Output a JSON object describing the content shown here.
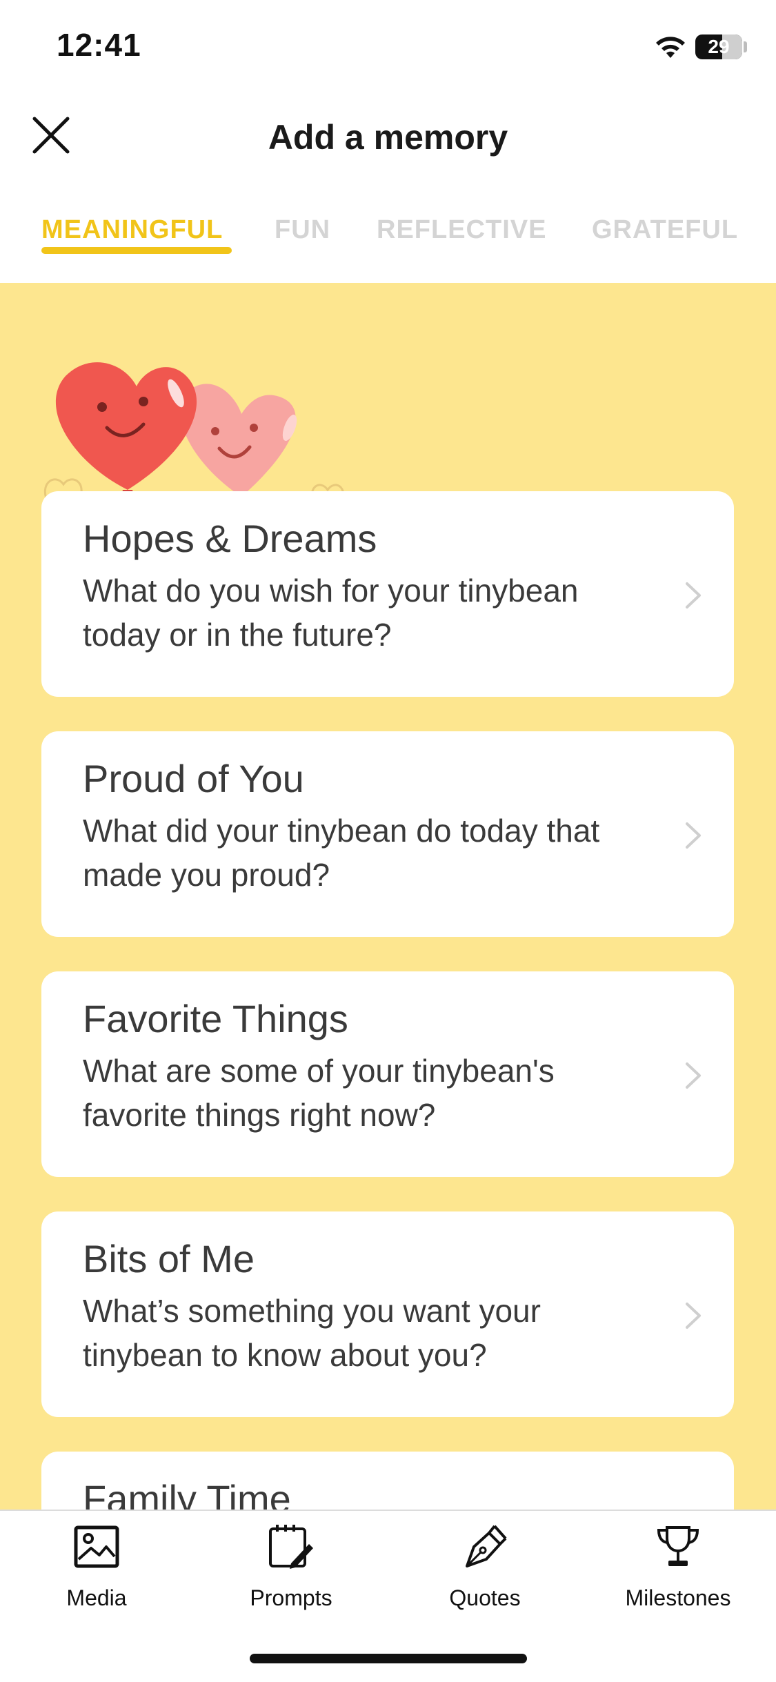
{
  "status_bar": {
    "time": "12:41",
    "battery": "29"
  },
  "header": {
    "title": "Add a memory"
  },
  "tabs": [
    {
      "label": "MEANINGFUL",
      "active": true
    },
    {
      "label": "FUN",
      "active": false
    },
    {
      "label": "REFLECTIVE",
      "active": false
    },
    {
      "label": "GRATEFUL",
      "active": false
    }
  ],
  "prompts": [
    {
      "title": "Hopes & Dreams",
      "description": "What do you wish for your tinybean today or in the future?"
    },
    {
      "title": "Proud of You",
      "description": "What did your tinybean do today that made you proud?"
    },
    {
      "title": "Favorite Things",
      "description": "What are some of your tinybean's favorite things right now?"
    },
    {
      "title": "Bits of Me",
      "description": "What’s something you want your tinybean to know about you?"
    },
    {
      "title": "Family Time",
      "description": ""
    }
  ],
  "bottom_nav": [
    {
      "label": "Media",
      "icon": "image-icon"
    },
    {
      "label": "Prompts",
      "icon": "notepad-pen-icon"
    },
    {
      "label": "Quotes",
      "icon": "pen-nib-icon"
    },
    {
      "label": "Milestones",
      "icon": "trophy-icon"
    }
  ],
  "colors": {
    "accent": "#f1c419",
    "background": "#fde68f",
    "heart_red": "#f0574f",
    "heart_pink": "#f7a5a1"
  }
}
